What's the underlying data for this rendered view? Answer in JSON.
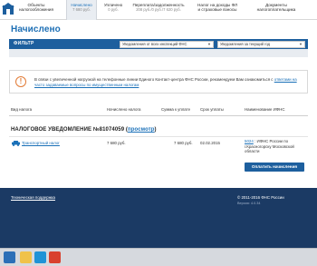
{
  "nav": {
    "tabs": [
      {
        "label": "Объекты",
        "label2": "налогообложения",
        "sub": ""
      },
      {
        "label": "Начислено",
        "label2": "",
        "sub": "7 680 руб."
      },
      {
        "label": "Уплачено",
        "label2": "",
        "sub": "0 руб."
      },
      {
        "label": "Переплата/задолженность",
        "label2": "",
        "sub": "208 руб./0 руб./7 620 руб."
      },
      {
        "label": "Налог на доходы ФЛ",
        "label2": "и страховые взносы",
        "sub": ""
      },
      {
        "label": "Документы",
        "label2": "налогоплательщика",
        "sub": ""
      }
    ]
  },
  "page": {
    "title": "Начислено"
  },
  "filter": {
    "label": "ФИЛЬТР",
    "select1": "Уведомления от всех инспекций ФНС",
    "select2": "Уведомления за текущий год"
  },
  "notice": {
    "text": "В связи с увеличенной нагрузкой на телефонные линии Единого Контакт-центра ФНС России, рекомендуем Вам ознакомиться с",
    "link": "ответами на часто задаваемые вопросы по имущественным налогам"
  },
  "table": {
    "headers": [
      "Вид налога",
      "Начислено налога",
      "Сумма к уплате",
      "Срок уплаты",
      "Наименование ИФНС"
    ]
  },
  "notification": {
    "title": "НАЛОГОВОЕ УВЕДОМЛЕНИЕ №81074059",
    "link": "просмотр"
  },
  "row": {
    "tax": "Транспортный налог",
    "accrued": "7 680 руб.",
    "amount": "7 680 руб.",
    "deadline": "02.02.2015",
    "ifns": "ИФНС России по г.Красногорску Московской области",
    "ifns_code": "5024"
  },
  "actions": {
    "pay_label": "Оплатить начисления"
  },
  "footer": {
    "support": "Техническая поддержка",
    "copyright": "© 2011-2016 ФНС России",
    "version": "Версия: 4.0.34"
  },
  "colors": {
    "brand": "#1d5f9e",
    "accent": "#1a70b8",
    "warning": "#e27b36",
    "footer": "#1b3a64"
  }
}
